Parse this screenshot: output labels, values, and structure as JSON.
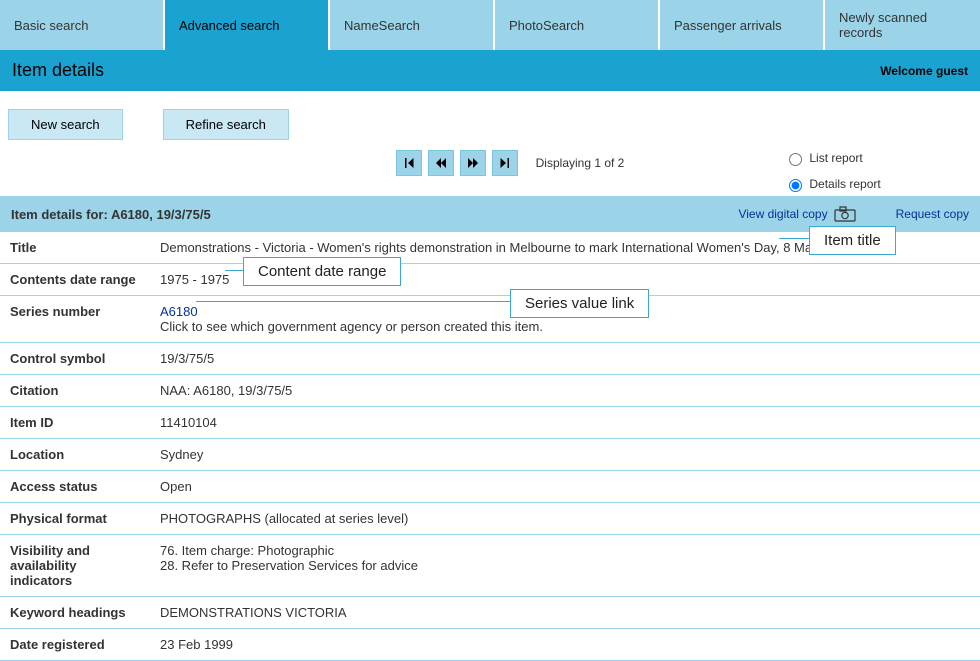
{
  "tabs": {
    "basic": "Basic search",
    "advanced": "Advanced search",
    "name": "NameSearch",
    "photo": "PhotoSearch",
    "passenger": "Passenger arrivals",
    "newly": "Newly scanned records"
  },
  "titlebar": {
    "title": "Item details",
    "welcome": "Welcome guest"
  },
  "buttons": {
    "new_search": "New search",
    "refine_search": "Refine search"
  },
  "pager": {
    "status": "Displaying 1 of 2",
    "list_report": "List report",
    "details_report": "Details report"
  },
  "detail_header": {
    "prefix": "Item details for: ",
    "ref": "A6180, 19/3/75/5",
    "view_digital": "View digital copy",
    "request_copy": "Request copy"
  },
  "fields": {
    "title": {
      "label": "Title",
      "value": "Demonstrations - Victoria - Women's rights demonstration in Melbourne to mark International Women's Day, 8 March 1975"
    },
    "contents_date_range": {
      "label": "Contents date range",
      "value": "1975 - 1975"
    },
    "series_number": {
      "label": "Series number",
      "link": "A6180",
      "hint": "Click to see which government agency or person created this item."
    },
    "control_symbol": {
      "label": "Control symbol",
      "value": "19/3/75/5"
    },
    "citation": {
      "label": "Citation",
      "value": "NAA: A6180, 19/3/75/5"
    },
    "item_id": {
      "label": "Item ID",
      "value": "11410104"
    },
    "location": {
      "label": "Location",
      "value": "Sydney"
    },
    "access_status": {
      "label": "Access status",
      "value": "Open"
    },
    "physical_format": {
      "label": "Physical format",
      "value": "PHOTOGRAPHS (allocated at series level)"
    },
    "visibility": {
      "label": "Visibility and availability indicators",
      "value1": "76. Item charge: Photographic",
      "value2": "28. Refer to Preservation Services for advice"
    },
    "keyword_headings": {
      "label": "Keyword headings",
      "value": "DEMONSTRATIONS VICTORIA"
    },
    "date_registered": {
      "label": "Date registered",
      "value": "23 Feb 1999"
    }
  },
  "callouts": {
    "item_title": "Item title",
    "content_date_range": "Content date range",
    "series_value_link": "Series value link"
  }
}
